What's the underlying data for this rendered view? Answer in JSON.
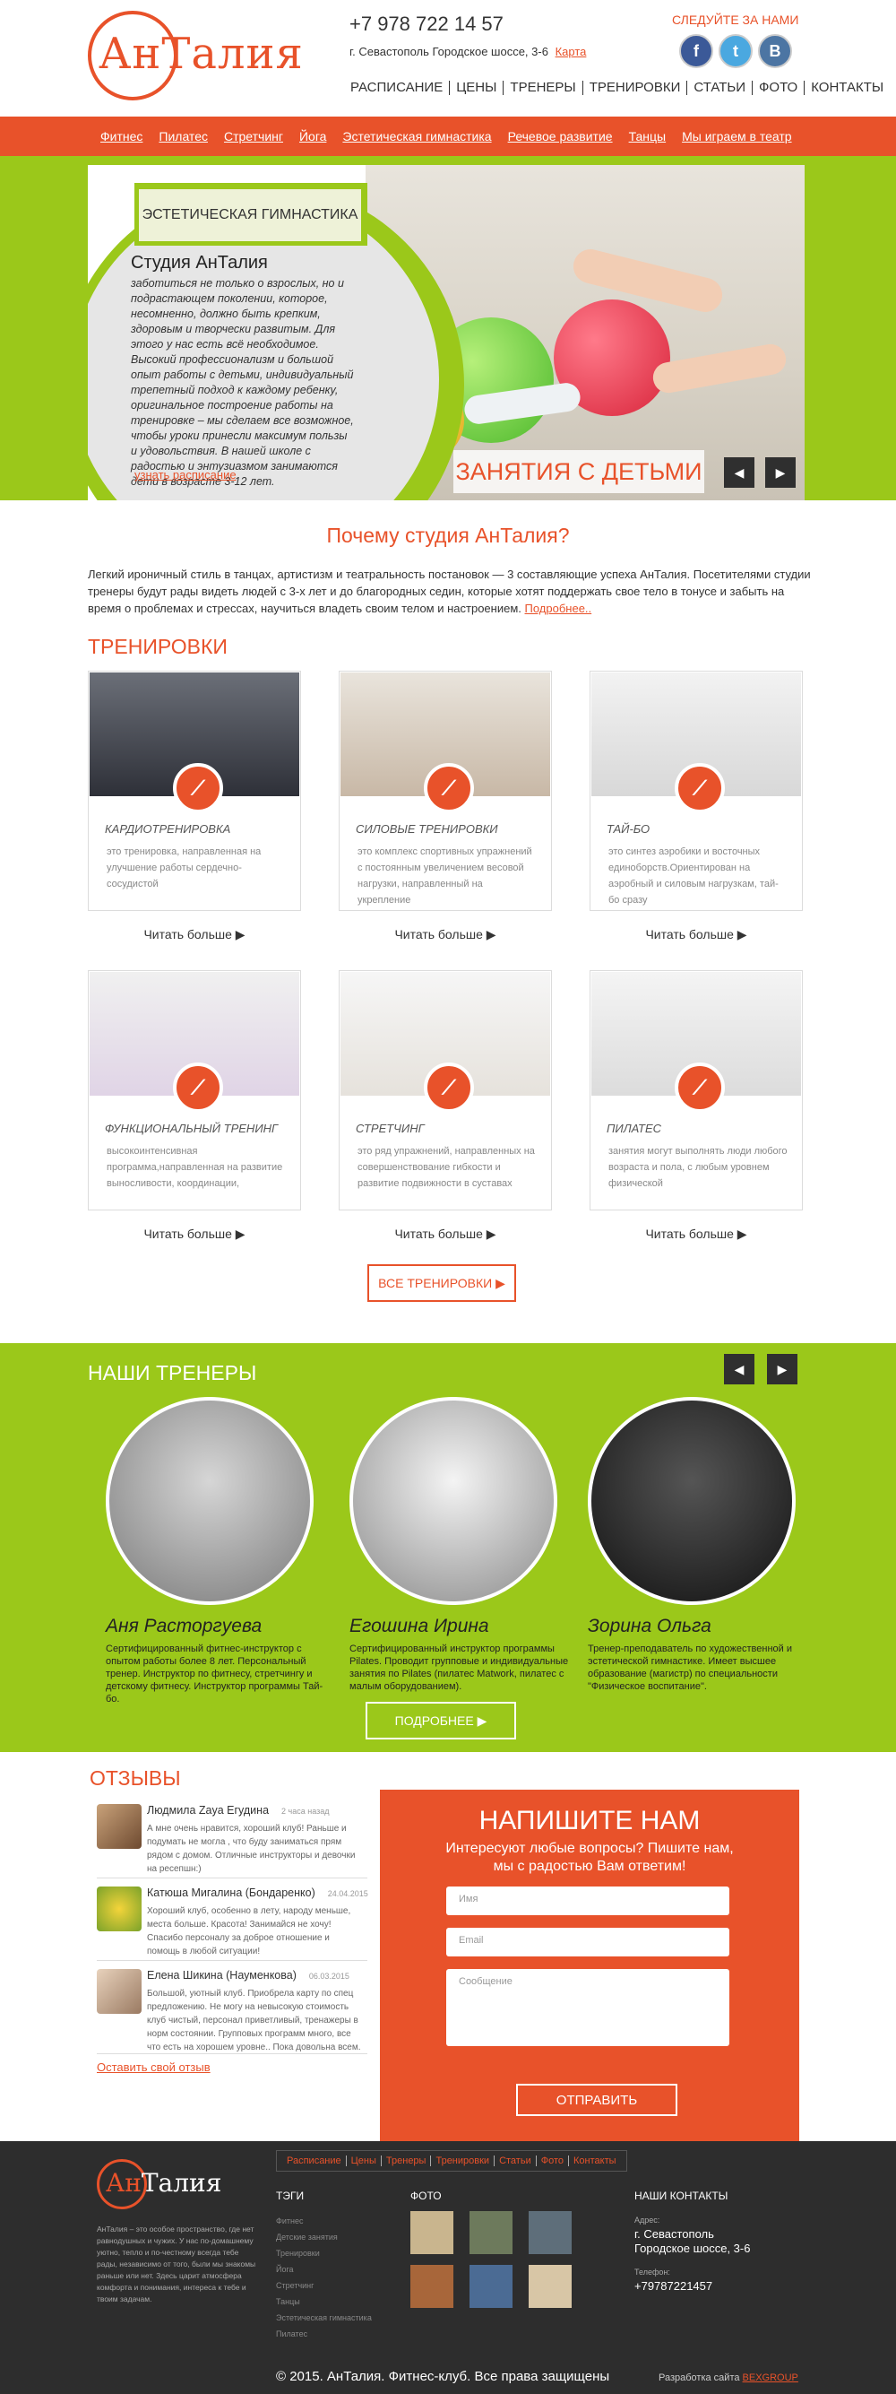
{
  "header": {
    "logo_part1": "Ан",
    "logo_part2": "Талия",
    "phone": "+7 978 722 14 57",
    "address": "г. Севастополь Городское шоссе, 3-6",
    "map_link": "Карта",
    "follow": "СЛЕДУЙТЕ ЗА НАМИ",
    "social": [
      "f",
      "t",
      "B"
    ],
    "nav": [
      "РАСПИСАНИЕ",
      "ЦЕНЫ",
      "ТРЕНЕРЫ",
      "ТРЕНИРОВКИ",
      "СТАТЬИ",
      "ФОТО",
      "КОНТАКТЫ"
    ]
  },
  "subnav": [
    "Фитнес",
    "Пилатес",
    "Стретчинг",
    "Йога",
    "Эстетическая гимнастика",
    "Речевое развитие",
    "Танцы",
    "Мы играем в театр"
  ],
  "hero": {
    "badge": "ЭСТЕТИЧЕСКАЯ ГИМНАСТИКА",
    "title": "Студия АнТалия",
    "text": "заботиться не только о взрослых, но и подрастающем поколении, которое, несомненно, должно быть крепким, здоровым и творчески развитым. Для этого у нас есть всё необходимое. Высокий профессионализм и большой опыт работы с детьми, индивидуальный трепетный подход к каждому ребенку, оригинальное построение работы на тренировке – мы сделаем все возможное, чтобы уроки принесли максимум пользы и удовольствия. В нашей школе с радостью и энтузиазмом занимаются дети в возрасте 3-12 лет.",
    "link": "узнать расписание",
    "caption": "ЗАНЯТИЯ С ДЕТЬМИ",
    "prev": "◀",
    "next": "▶"
  },
  "why": {
    "title": "Почему студия АнТалия?",
    "text": "Легкий ироничный стиль в танцах, артистизм и театральность постановок — 3 составляющие успеха АнТалия. Посетителями студии тренеры будут рады видеть людей с 3-х лет и до благородных седин, которые хотят поддержать свое тело в тонусе и забыть на время о проблемах и стрессах, научиться владеть своим телом и настроением.",
    "more": "Подробнее.."
  },
  "trainings": {
    "title": "ТРЕНИРОВКИ",
    "read_more": "Читать больше ▶",
    "all_button": "ВСЕ ТРЕНИРОВКИ ▶",
    "icon": "⟋",
    "items": [
      {
        "title": "КАРДИОТРЕНИРОВКА",
        "desc": "это тренировка, направленная на улучшение работы сердечно-сосудистой"
      },
      {
        "title": "СИЛОВЫЕ ТРЕНИРОВКИ",
        "desc": "это комплекс спортивных упражнений с постоянным увеличением весовой нагрузки, направленный на укрепление"
      },
      {
        "title": "ТАЙ-БО",
        "desc": "это синтез аэробики и восточных единоборств.Ориентирован на аэробный и силовым нагрузкам, тай-бо сразу"
      },
      {
        "title": "ФУНКЦИОНАЛЬНЫЙ ТРЕНИНГ",
        "desc": "высокоинтенсивная программа,направленная на развитие выносливости, координации,"
      },
      {
        "title": "СТРЕТЧИНГ",
        "desc": "это ряд упражнений, направленных на совершенствование гибкости и развитие подвижности в суставах"
      },
      {
        "title": "ПИЛАТЕС",
        "desc": "занятия могут выполнять люди любого возраста и пола, с любым уровнем физической"
      }
    ]
  },
  "trainers": {
    "title": "НАШИ ТРЕНЕРЫ",
    "prev": "◀",
    "next": "▶",
    "more_button": "ПОДРОБНЕЕ ▶",
    "items": [
      {
        "name": "Аня Расторгуева",
        "desc": "Сертифицированный фитнес-инструктор с опытом работы более 8 лет. Персональный тренер. Инструктор по фитнесу, стретчингу и детскому фитнесу. Инструктор программы Тай-бо."
      },
      {
        "name": "Егошина Ирина",
        "desc": "Сертифицированный инструктор программы Pilates. Проводит групповые и индивидуальные занятия по Pilates (пилатес Matwork, пилатес с малым оборудованием)."
      },
      {
        "name": "Зорина Ольга",
        "desc": "Тренер-преподаватель по художественной и эстетической гимнастике. Имеет высшее образование (магистр) по специальности \"Физическое воспитание\"."
      }
    ]
  },
  "reviews": {
    "title": "ОТЗЫВЫ",
    "leave": "Оставить свой отзыв",
    "items": [
      {
        "name": "Людмила Zaya Егудина",
        "time": "2 часа назад",
        "text": "А мне очень нравится, хороший клуб! Раньше и подумать не могла , что буду заниматься прям рядом с домом. Отличные инструкторы и девочки на ресепшн:)"
      },
      {
        "name": "Катюша Мигалина (Бондаренко)",
        "time": "24.04.2015",
        "text": "Хороший клуб, особенно в лету, народу меньше, места больше. Красота! Занимайся не хочу! Спасибо персоналу за доброе отношение и помощь в любой ситуации!"
      },
      {
        "name": "Елена Шикина (Науменкова)",
        "time": "06.03.2015",
        "text": "Большой, уютный клуб. Приобрела карту по спец предложению. Не могу на невысокую стоимость клуб чистый, персонал приветливый, тренажеры в норм состоянии. Групповых программ много, все что есть на хорошем уровне.. Пока довольна всем."
      }
    ]
  },
  "contact_form": {
    "title": "НАПИШИТЕ НАМ",
    "subtitle": "Интересуют любые вопросы? Пишите нам, мы с радостью Вам ответим!",
    "name_placeholder": "Имя",
    "email_placeholder": "Email",
    "message_placeholder": "Сообщение",
    "submit": "ОТПРАВИТЬ"
  },
  "footer": {
    "about": "АнТалия – это особое пространство, где нет равнодушных и чужих. У нас по-домашнему уютно, тепло и по-честному всегда тебе рады, независимо от того, были мы знакомы раньше или нет. Здесь царит атмосфера комфорта и понимания, интереса к тебе и твоим задачам.",
    "nav": [
      "Расписание",
      "Цены",
      "Тренеры",
      "Тренировки",
      "Статьи",
      "Фото",
      "Контакты"
    ],
    "tags_title": "ТЭГИ",
    "tags": [
      "Фитнес",
      "Детские занятия",
      "Тренировки",
      "Йога",
      "Стретчинг",
      "Танцы",
      "Эстетическая гимнастика",
      "Пилатес"
    ],
    "photos_title": "ФОТО",
    "contacts_title": "НАШИ КОНТАКТЫ",
    "address_label": "Адрес:",
    "address_line1": "г. Севастополь",
    "address_line2": "Городское шоссе, 3-6",
    "phone_label": "Телефон:",
    "phone": "+79787221457",
    "copyright": "© 2015. АнТалия. Фитнес-клуб. Все права защищены",
    "dev_label": "Разработка сайта",
    "dev_link": "BEXGROUP"
  },
  "colors": {
    "accent": "#e8522a",
    "green": "#9bc81a",
    "footer_bg": "#2d2d2d"
  }
}
